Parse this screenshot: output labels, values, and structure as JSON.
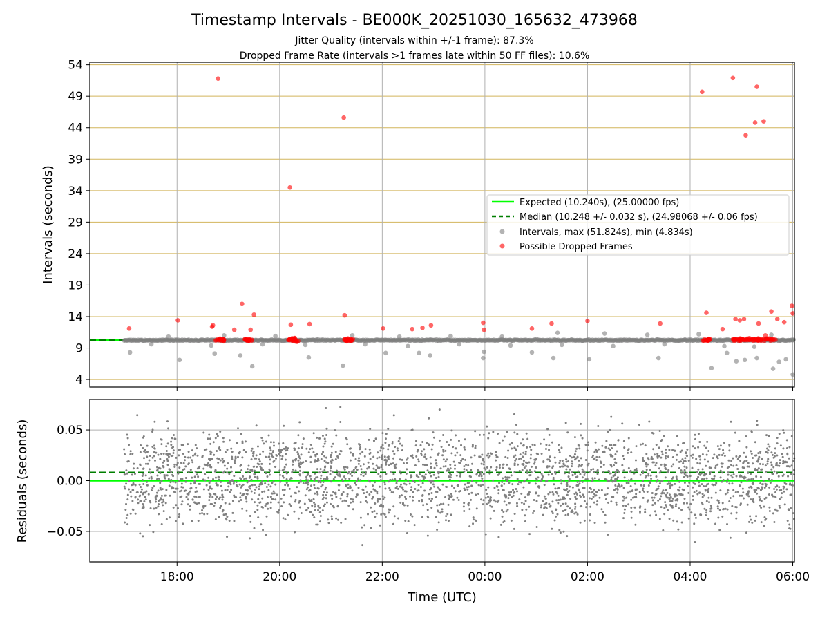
{
  "figure": {
    "title": "Timestamp Intervals - BE000K_20251030_165632_473968",
    "subtitle_line1": "Jitter Quality (intervals within +/-1 frame): 87.3%",
    "subtitle_line2": "Dropped Frame Rate (intervals >1 frames late within 50 FF files): 10.6%"
  },
  "colors": {
    "expected": "#00ff00",
    "median": "#007f00",
    "intervals": "#808080",
    "dropped": "#ff0000",
    "hgrid_top": "#d2b55b",
    "grid": "#b0b0b0"
  },
  "chart_data": [
    {
      "type": "scatter",
      "panel": "intervals",
      "ylabel": "Intervals (seconds)",
      "xlabel": "",
      "x_unit": "hours since 16:00 UTC on 2025-10-30",
      "xlim": [
        "16:18",
        "06:02"
      ],
      "ylim": [
        2.8,
        54.4
      ],
      "yticks": [
        4,
        9,
        14,
        19,
        24,
        29,
        34,
        39,
        44,
        49,
        54
      ],
      "ytick_labels": [
        "4",
        "9",
        "14",
        "19",
        "24",
        "29",
        "34",
        "39",
        "44",
        "49",
        "54"
      ],
      "grid": true,
      "legend_position": "center-right",
      "expected_value": 10.24,
      "median_value": 10.248,
      "legend": {
        "expected": "Expected (10.240s), (25.00000 fps)",
        "median": "Median (10.248 +/- 0.032 s), (24.98068 +/- 0.06 fps)",
        "intervals": "Intervals, max (51.824s), min (4.834s)",
        "dropped": "Possible Dropped Frames"
      },
      "series": [
        {
          "name": "Possible Dropped Frames",
          "points": [
            [
              "17:04",
              12.1
            ],
            [
              "18:01",
              13.4
            ],
            [
              "18:41",
              12.4
            ],
            [
              "18:42",
              12.6
            ],
            [
              "18:48",
              51.8
            ],
            [
              "19:07",
              11.9
            ],
            [
              "19:16",
              16.0
            ],
            [
              "19:26",
              11.9
            ],
            [
              "19:30",
              14.3
            ],
            [
              "20:12",
              34.5
            ],
            [
              "20:13",
              12.7
            ],
            [
              "20:35",
              12.8
            ],
            [
              "21:15",
              45.6
            ],
            [
              "21:16",
              14.2
            ],
            [
              "22:01",
              12.1
            ],
            [
              "22:35",
              12.0
            ],
            [
              "22:47",
              12.2
            ],
            [
              "22:57",
              12.6
            ],
            [
              "23:58",
              13.0
            ],
            [
              "23:59",
              11.9
            ],
            [
              "00:55",
              12.1
            ],
            [
              "01:18",
              12.9
            ],
            [
              "02:00",
              13.3
            ],
            [
              "03:25",
              12.9
            ],
            [
              "04:14",
              49.7
            ],
            [
              "04:19",
              14.6
            ],
            [
              "04:38",
              12.0
            ],
            [
              "04:50",
              51.9
            ],
            [
              "04:53",
              13.6
            ],
            [
              "04:58",
              13.4
            ],
            [
              "05:03",
              13.6
            ],
            [
              "05:05",
              42.8
            ],
            [
              "05:16",
              44.8
            ],
            [
              "05:18",
              50.5
            ],
            [
              "05:20",
              12.9
            ],
            [
              "05:26",
              45.0
            ],
            [
              "05:28",
              11.0
            ],
            [
              "05:35",
              14.8
            ],
            [
              "05:42",
              13.6
            ],
            [
              "05:50",
              13.1
            ],
            [
              "05:59",
              15.7
            ],
            [
              "06:00",
              14.5
            ]
          ]
        },
        {
          "name": "Intervals, max (51.824s), min (4.834s)",
          "points": [
            [
              "17:05",
              8.3
            ],
            [
              "18:03",
              7.1
            ],
            [
              "18:44",
              8.1
            ],
            [
              "19:14",
              7.8
            ],
            [
              "19:28",
              6.1
            ],
            [
              "20:34",
              7.5
            ],
            [
              "21:14",
              6.2
            ],
            [
              "22:04",
              8.2
            ],
            [
              "22:43",
              8.2
            ],
            [
              "22:56",
              7.8
            ],
            [
              "23:58",
              7.4
            ],
            [
              "23:59",
              8.4
            ],
            [
              "00:55",
              8.3
            ],
            [
              "01:20",
              7.4
            ],
            [
              "02:02",
              7.2
            ],
            [
              "03:23",
              7.4
            ],
            [
              "04:25",
              5.8
            ],
            [
              "04:43",
              8.2
            ],
            [
              "04:54",
              6.9
            ],
            [
              "05:04",
              7.1
            ],
            [
              "05:18",
              7.4
            ],
            [
              "05:37",
              5.7
            ],
            [
              "05:44",
              6.8
            ],
            [
              "05:52",
              7.2
            ],
            [
              "06:00",
              4.8
            ],
            [
              "17:30",
              9.6
            ],
            [
              "18:40",
              9.4
            ],
            [
              "19:40",
              9.6
            ],
            [
              "20:30",
              9.5
            ],
            [
              "21:40",
              9.6
            ],
            [
              "22:30",
              9.3
            ],
            [
              "23:30",
              9.6
            ],
            [
              "00:30",
              9.4
            ],
            [
              "01:30",
              9.5
            ],
            [
              "02:30",
              9.3
            ],
            [
              "03:30",
              9.6
            ],
            [
              "04:40",
              9.3
            ],
            [
              "05:15",
              9.2
            ],
            [
              "17:50",
              10.8
            ],
            [
              "18:55",
              11.0
            ],
            [
              "19:55",
              10.9
            ],
            [
              "21:25",
              11.0
            ],
            [
              "22:20",
              10.8
            ],
            [
              "23:20",
              10.9
            ],
            [
              "00:20",
              10.8
            ],
            [
              "01:25",
              11.4
            ],
            [
              "02:20",
              11.3
            ],
            [
              "03:10",
              11.1
            ],
            [
              "04:10",
              11.2
            ],
            [
              "05:35",
              11.1
            ]
          ]
        }
      ]
    },
    {
      "type": "scatter",
      "panel": "residuals",
      "ylabel": "Residuals (seconds)",
      "xlabel": "Time (UTC)",
      "xticks": [
        "18:00",
        "20:00",
        "22:00",
        "00:00",
        "02:00",
        "04:00",
        "06:00"
      ],
      "ylim": [
        -0.08,
        0.08
      ],
      "yticks": [
        -0.05,
        0.0,
        0.05
      ],
      "ytick_labels": [
        "−0.05",
        "0.00",
        "0.05"
      ],
      "grid": true,
      "expected_value": 0.0,
      "median_value": 0.008,
      "series": [
        {
          "name": "Residuals",
          "x_range": [
            "16:58",
            "06:02"
          ],
          "y_range": [
            -0.08,
            0.078
          ],
          "count": 2900
        }
      ]
    }
  ]
}
